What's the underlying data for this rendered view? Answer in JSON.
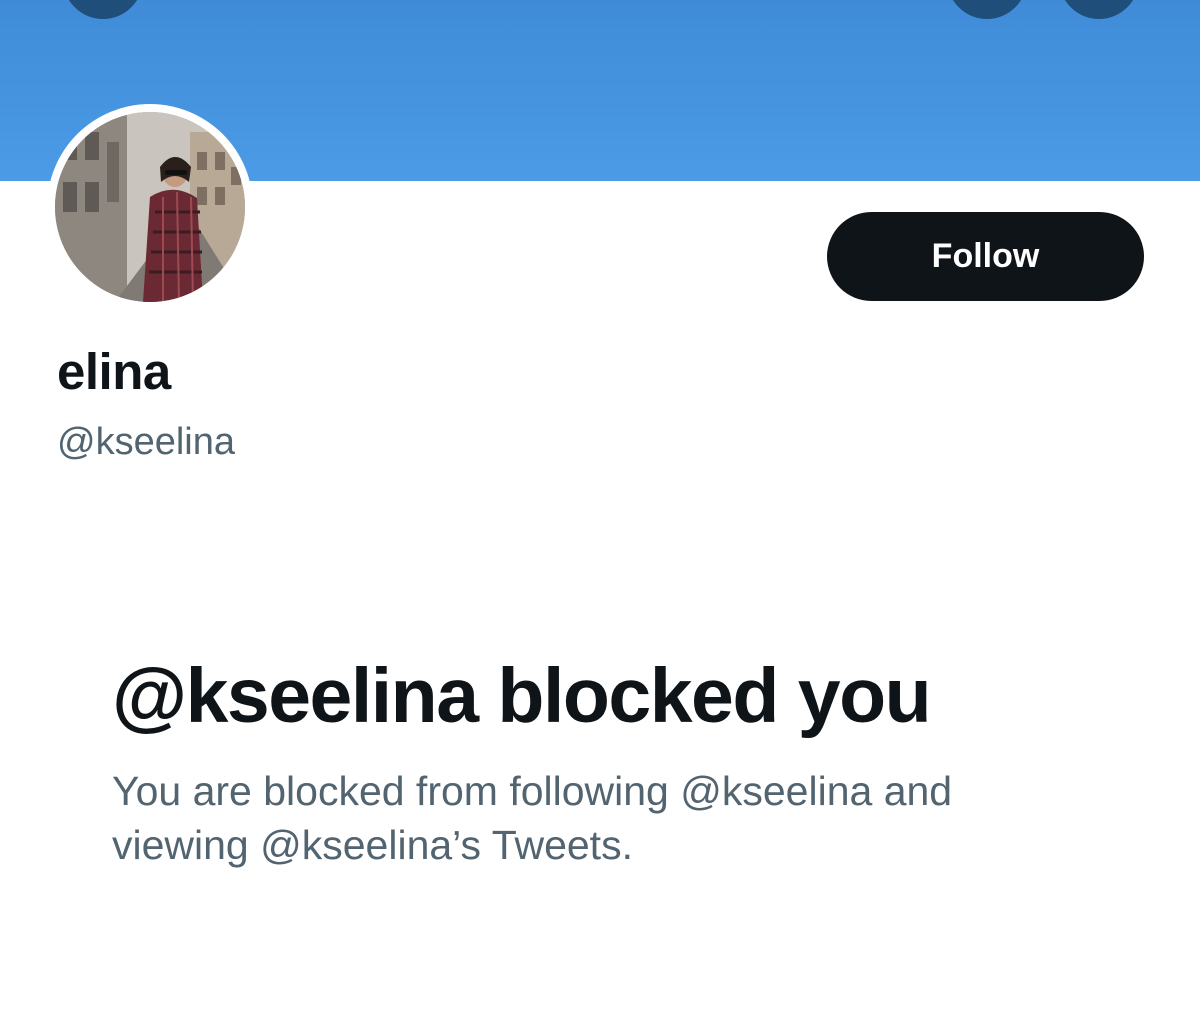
{
  "colors": {
    "banner": "#4b9be6",
    "follow_button_bg": "#0f1419",
    "follow_button_text": "#ffffff",
    "primary_text": "#0f1419",
    "secondary_text": "#536471"
  },
  "header": {
    "back_icon": "arrow-left-icon",
    "search_icon": "search-icon",
    "more_icon": "more-icon"
  },
  "profile": {
    "display_name": "elina",
    "handle": "@kseelina",
    "follow_label": "Follow"
  },
  "blocked_notice": {
    "title": "@kseelina blocked you",
    "description": "You are blocked from following @kseelina and viewing @kseelina’s Tweets."
  }
}
